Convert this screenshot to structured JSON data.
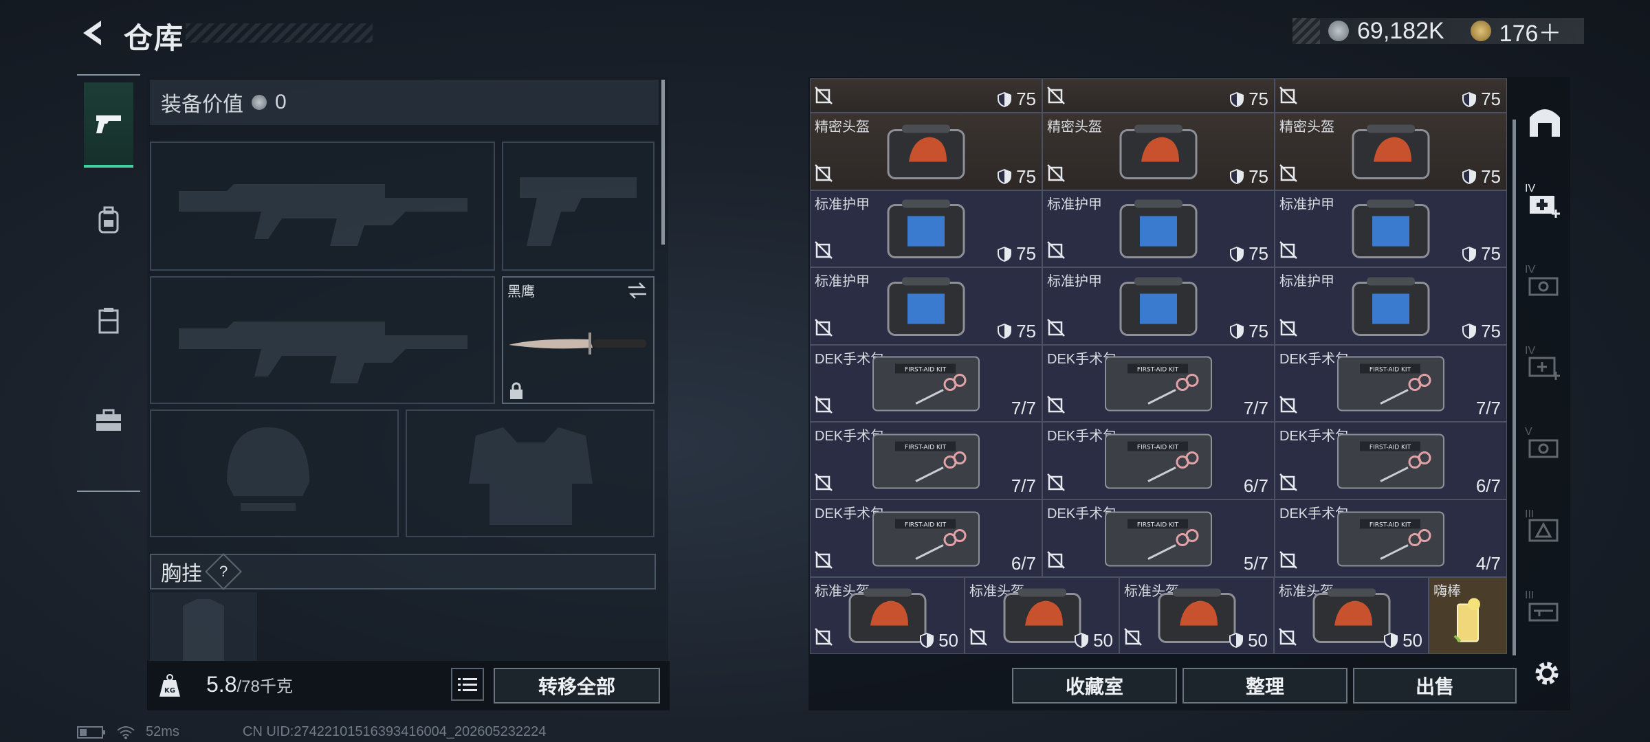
{
  "header": {
    "title": "仓库",
    "currency1": "69,182K",
    "currency2": "176＋"
  },
  "equip": {
    "value_label": "装备价值",
    "value": "0",
    "knife_name": "黑鹰",
    "chest_label": "胸挂",
    "chest_hint": "?",
    "weight_current": "5.8",
    "weight_max": "/78千克",
    "transfer_all": "转移全部"
  },
  "storage": {
    "rows": [
      [
        {
          "name": "",
          "value": "75",
          "type": "helm",
          "shield": true
        },
        {
          "name": "",
          "value": "75",
          "type": "helm",
          "shield": true
        },
        {
          "name": "",
          "value": "75",
          "type": "helm",
          "shield": true
        }
      ],
      [
        {
          "name": "精密头盔",
          "value": "75",
          "type": "helm",
          "shield": true
        },
        {
          "name": "精密头盔",
          "value": "75",
          "type": "helm",
          "shield": true
        },
        {
          "name": "精密头盔",
          "value": "75",
          "type": "helm",
          "shield": true
        }
      ],
      [
        {
          "name": "标准护甲",
          "value": "75",
          "type": "armor",
          "shield": true
        },
        {
          "name": "标准护甲",
          "value": "75",
          "type": "armor",
          "shield": true
        },
        {
          "name": "标准护甲",
          "value": "75",
          "type": "armor",
          "shield": true
        }
      ],
      [
        {
          "name": "标准护甲",
          "value": "75",
          "type": "armor",
          "shield": true
        },
        {
          "name": "标准护甲",
          "value": "75",
          "type": "armor",
          "shield": true
        },
        {
          "name": "标准护甲",
          "value": "75",
          "type": "armor",
          "shield": true
        }
      ],
      [
        {
          "name": "DEK手术包",
          "value": "7/7",
          "type": "kit"
        },
        {
          "name": "DEK手术包",
          "value": "7/7",
          "type": "kit"
        },
        {
          "name": "DEK手术包",
          "value": "7/7",
          "type": "kit"
        }
      ],
      [
        {
          "name": "DEK手术包",
          "value": "7/7",
          "type": "kit"
        },
        {
          "name": "DEK手术包",
          "value": "6/7",
          "type": "kit"
        },
        {
          "name": "DEK手术包",
          "value": "6/7",
          "type": "kit"
        }
      ],
      [
        {
          "name": "DEK手术包",
          "value": "6/7",
          "type": "kit"
        },
        {
          "name": "DEK手术包",
          "value": "5/7",
          "type": "kit"
        },
        {
          "name": "DEK手术包",
          "value": "4/7",
          "type": "kit"
        }
      ]
    ],
    "bottom_row": [
      {
        "name": "标准头盔",
        "value": "50"
      },
      {
        "name": "标准头盔",
        "value": "50"
      },
      {
        "name": "标准头盔",
        "value": "50"
      },
      {
        "name": "标准头盔",
        "value": "50"
      }
    ],
    "drink_name": "嗨棒",
    "kit_box_text": "FIRST-AID KIT"
  },
  "right_tiers": [
    "IV",
    "IV",
    "IV",
    "V",
    "III",
    "III"
  ],
  "buttons": {
    "collection": "收藏室",
    "organize": "整理",
    "sell": "出售"
  },
  "status": {
    "ping": "52ms",
    "uid": "CN UID:2742210151639341​6004_202605232224"
  },
  "colors": {
    "accent": "#3fd1a0",
    "helmet_cell": "#3a3330",
    "normal_cell": "#2a2d44"
  }
}
